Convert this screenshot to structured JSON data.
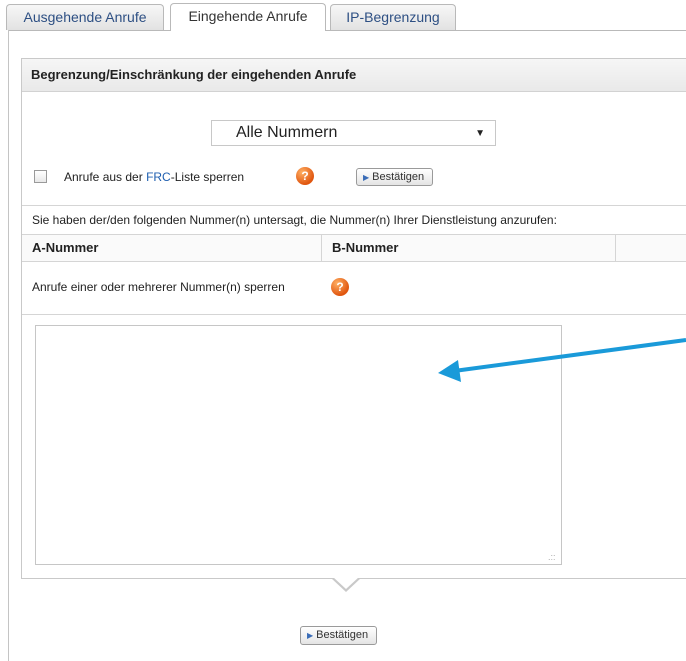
{
  "tabs": [
    {
      "label": "Ausgehende Anrufe",
      "active": false
    },
    {
      "label": "Eingehende Anrufe",
      "active": true
    },
    {
      "label": "IP-Begrenzung",
      "active": false
    }
  ],
  "panel": {
    "title": "Begrenzung/Einschränkung der eingehenden Anrufe",
    "number_filter": {
      "selected": "Alle Nummern"
    },
    "frc_checkbox": {
      "label_before": "Anrufe aus der ",
      "label_link": "FRC",
      "label_after": "-Liste sperren",
      "checked": false,
      "help_icon": "help-icon"
    },
    "confirm_label": "Bestätigen",
    "notice": "Sie haben der/den folgenden Nummer(n) untersagt, die Nummer(n) Ihrer Dienstleistung anzurufen:",
    "table": {
      "columns": [
        "A-Nummer",
        "B-Nummer",
        ""
      ]
    },
    "block_numbers_label": "Anrufe einer oder mehrerer Nummer(n) sperren",
    "textarea_value": ""
  },
  "footer": {
    "confirm_label": "Bestätigen"
  },
  "annotation": {
    "arrow_color": "#1a9ad9"
  },
  "colors": {
    "link": "#1f5fb0",
    "help_icon": "#e0560f"
  }
}
